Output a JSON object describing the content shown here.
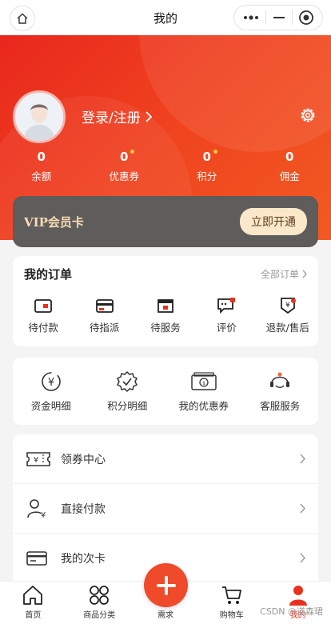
{
  "header": {
    "title": "我的"
  },
  "profile": {
    "login_label": "登录/注册"
  },
  "stats": [
    {
      "value": "0",
      "label": "余额",
      "dot": false
    },
    {
      "value": "0",
      "label": "优惠券",
      "dot": true
    },
    {
      "value": "0",
      "label": "积分",
      "dot": true
    },
    {
      "value": "0",
      "label": "佣金",
      "dot": false
    }
  ],
  "vip": {
    "title": "VIP会员卡",
    "button": "立即开通"
  },
  "orders": {
    "title": "我的订单",
    "all_label": "全部订单",
    "items": [
      {
        "label": "待付款",
        "icon": "wallet-icon"
      },
      {
        "label": "待指派",
        "icon": "card-icon"
      },
      {
        "label": "待服务",
        "icon": "shop-icon"
      },
      {
        "label": "评价",
        "icon": "comment-icon"
      },
      {
        "label": "退款/售后",
        "icon": "refund-icon"
      }
    ]
  },
  "services": [
    {
      "label": "资金明细",
      "icon": "yuan-cycle-icon"
    },
    {
      "label": "积分明细",
      "icon": "check-badge-icon"
    },
    {
      "label": "我的优惠券",
      "icon": "coupon-icon"
    },
    {
      "label": "客服服务",
      "icon": "headset-icon"
    }
  ],
  "menu": [
    {
      "label": "领券中心",
      "icon": "ticket-icon"
    },
    {
      "label": "直接付款",
      "icon": "user-pay-icon"
    },
    {
      "label": "我的次卡",
      "icon": "card-icon"
    }
  ],
  "tabbar": [
    {
      "label": "首页",
      "icon": "home-icon"
    },
    {
      "label": "商品分类",
      "icon": "grid-icon"
    },
    {
      "label": "需求",
      "icon": "plus-icon"
    },
    {
      "label": "购物车",
      "icon": "cart-icon"
    },
    {
      "label": "我的",
      "icon": "person-icon",
      "active": true
    }
  ],
  "watermark": "CSDN @道森珺",
  "colors": {
    "accent": "#e8311d",
    "vip_bg": "#5f5c5c",
    "vip_gold": "#f6dcb0"
  }
}
